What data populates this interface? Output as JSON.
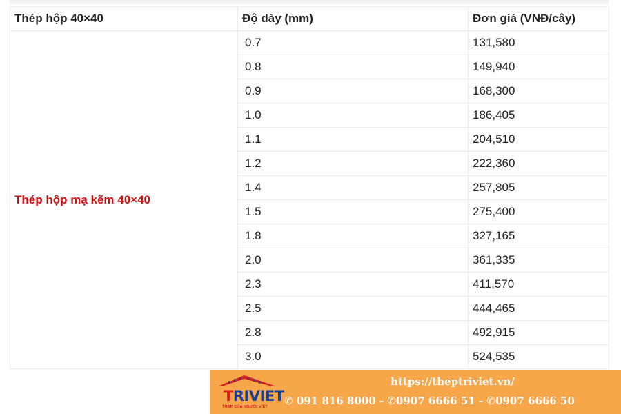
{
  "table": {
    "headers": [
      "Thép hộp 40×40",
      "Độ dày (mm)",
      "Đơn giá (VNĐ/cây)"
    ],
    "product_name": "Thép hộp mạ kẽm 40×40",
    "rows": [
      {
        "thickness": "0.7",
        "price": "131,580"
      },
      {
        "thickness": "0.8",
        "price": "149,940"
      },
      {
        "thickness": "0.9",
        "price": "168,300"
      },
      {
        "thickness": "1.0",
        "price": "186,405"
      },
      {
        "thickness": "1.1",
        "price": "204,510"
      },
      {
        "thickness": "1.2",
        "price": "222,360"
      },
      {
        "thickness": "1.4",
        "price": "257,805"
      },
      {
        "thickness": "1.5",
        "price": "275,400"
      },
      {
        "thickness": "1.8",
        "price": "327,165"
      },
      {
        "thickness": "2.0",
        "price": "361,335"
      },
      {
        "thickness": "2.3",
        "price": "411,570"
      },
      {
        "thickness": "2.5",
        "price": "444,465"
      },
      {
        "thickness": "2.8",
        "price": "492,915"
      },
      {
        "thickness": "3.0",
        "price": "524,535"
      }
    ]
  },
  "banner": {
    "logo_text_t": "T",
    "logo_text_rest": "RIVIET",
    "logo_tagline": "THÉP CỦA NGƯỜI VIỆT",
    "url": "https://theptriviet.vn/",
    "phone_icon": "phone-icon",
    "phone_1": "091 816 8000",
    "phone_2": "0907 6666 51",
    "phone_3": "0907 6666 50",
    "separator": " - ",
    "colors": {
      "background": "#f7a64a",
      "logo_blue": "#1d3f8f",
      "logo_red": "#d4201f"
    }
  },
  "colors": {
    "product_name": "#cc1111",
    "border": "#ececec"
  }
}
